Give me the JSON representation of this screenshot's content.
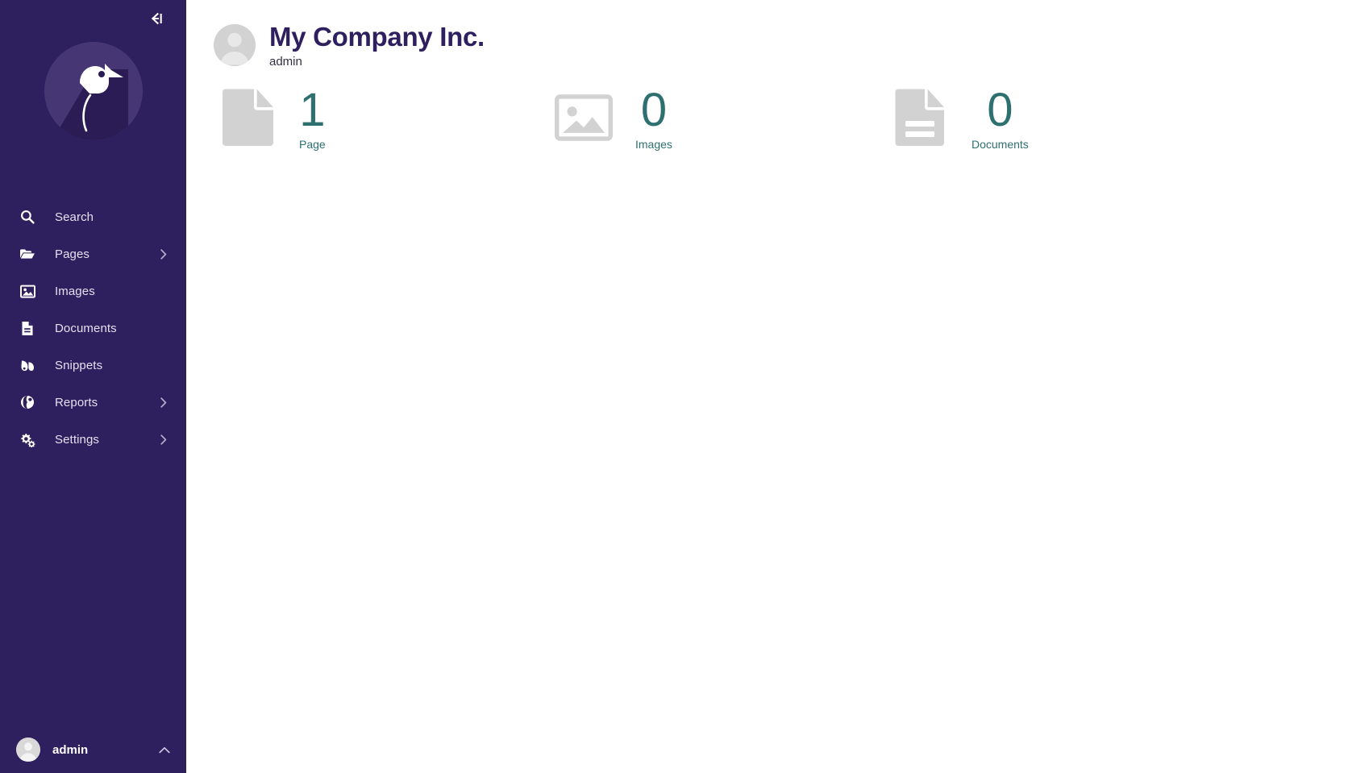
{
  "sidebar": {
    "collapse_icon": "collapse-menu-icon",
    "logo": "wagtail-bird-logo",
    "items": [
      {
        "label": "Search",
        "icon": "search-icon",
        "has_chevron": false
      },
      {
        "label": "Pages",
        "icon": "folder-open-icon",
        "has_chevron": true
      },
      {
        "label": "Images",
        "icon": "image-icon",
        "has_chevron": false
      },
      {
        "label": "Documents",
        "icon": "document-icon",
        "has_chevron": false
      },
      {
        "label": "Snippets",
        "icon": "snippet-icon",
        "has_chevron": false
      },
      {
        "label": "Reports",
        "icon": "globe-icon",
        "has_chevron": true
      },
      {
        "label": "Settings",
        "icon": "cogs-icon",
        "has_chevron": true
      }
    ],
    "footer": {
      "username": "admin",
      "avatar_icon": "user-avatar-icon",
      "chevron_icon": "chevron-up-icon"
    },
    "background_color": "#2E1F5E"
  },
  "header": {
    "avatar_icon": "user-avatar-icon",
    "site_title": "My Company Inc.",
    "username": "admin",
    "title_color": "#2E1F5E"
  },
  "summary": {
    "accent_color": "#2E7070",
    "items": [
      {
        "count": "1",
        "label": "Page",
        "icon": "page-icon"
      },
      {
        "count": "0",
        "label": "Images",
        "icon": "images-icon"
      },
      {
        "count": "0",
        "label": "Documents",
        "icon": "documents-icon"
      }
    ]
  }
}
